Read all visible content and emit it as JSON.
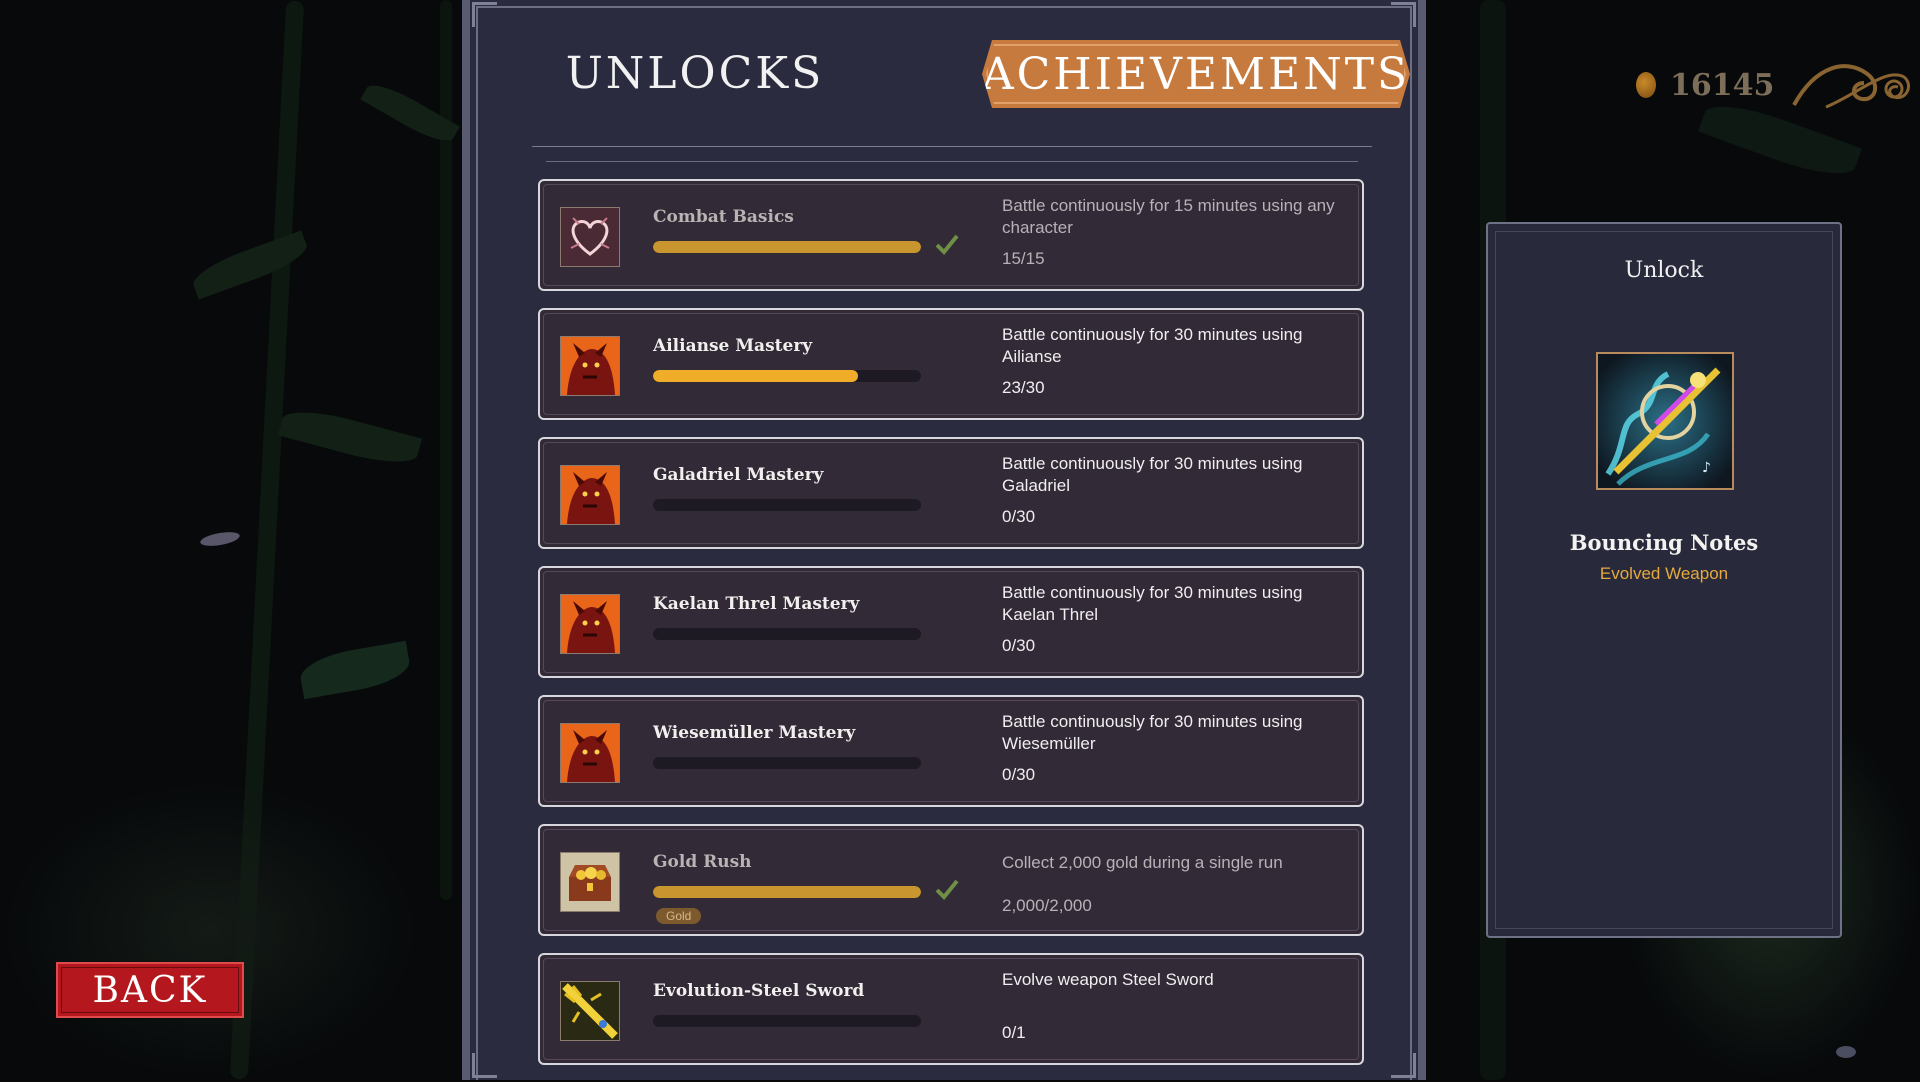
{
  "currency": {
    "amount": "16145",
    "icon": "gold-coin-icon",
    "ornament": "swirl-ornament-icon"
  },
  "tabs": {
    "unlocks": "UNLOCKS",
    "achievements": "ACHIEVEMENTS",
    "active": "achievements"
  },
  "achievements": [
    {
      "title": "Combat Basics",
      "description": "Battle continuously for 15 minutes using any character",
      "progress_text": "15/15",
      "progress": 1.0,
      "completed": true,
      "icon": "heart-icon",
      "tag": ""
    },
    {
      "title": "Ailianse Mastery",
      "description": "Battle continuously for 30 minutes using Ailianse",
      "progress_text": "23/30",
      "progress": 0.7667,
      "completed": false,
      "icon": "demon-portrait-icon",
      "tag": ""
    },
    {
      "title": "Galadriel Mastery",
      "description": "Battle continuously for 30 minutes using Galadriel",
      "progress_text": "0/30",
      "progress": 0,
      "completed": false,
      "icon": "demon-portrait-icon",
      "tag": ""
    },
    {
      "title": "Kaelan Threl Mastery",
      "description": "Battle continuously for 30 minutes using Kaelan Threl",
      "progress_text": "0/30",
      "progress": 0,
      "completed": false,
      "icon": "demon-portrait-icon",
      "tag": ""
    },
    {
      "title": "Wiesemüller Mastery",
      "description": "Battle continuously for 30 minutes using Wiesemüller",
      "progress_text": "0/30",
      "progress": 0,
      "completed": false,
      "icon": "demon-portrait-icon",
      "tag": ""
    },
    {
      "title": "Gold Rush",
      "description": "Collect 2,000 gold during a single run",
      "progress_text": "2,000/2,000",
      "progress": 1.0,
      "completed": true,
      "icon": "treasure-chest-icon",
      "tag": "Gold"
    },
    {
      "title": "Evolution-Steel Sword",
      "description": "Evolve weapon Steel Sword",
      "progress_text": "0/1",
      "progress": 0,
      "completed": false,
      "icon": "golden-sword-icon",
      "tag": ""
    }
  ],
  "unlock_panel": {
    "title": "Unlock",
    "item_name": "Bouncing Notes",
    "item_type": "Evolved Weapon",
    "icon": "bouncing-notes-weapon-icon"
  },
  "back_label": "BACK",
  "colors": {
    "accent_orange": "#c77a3e",
    "progress_gold": "#c9952e",
    "progress_active": "#f0ad2a",
    "check_green": "#6e8f45",
    "type_gold": "#e6a93c",
    "back_red": "#b4181e"
  }
}
